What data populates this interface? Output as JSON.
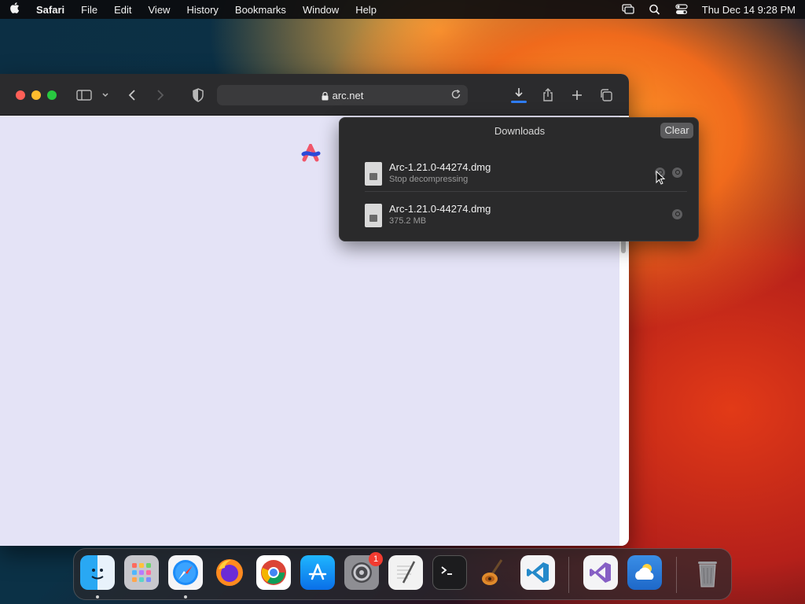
{
  "menubar": {
    "apple": "",
    "app_name": "Safari",
    "menus": [
      "File",
      "Edit",
      "View",
      "History",
      "Bookmarks",
      "Window",
      "Help"
    ],
    "datetime": "Thu Dec 14  9:28 PM"
  },
  "safari": {
    "url": "arc.net",
    "toolbar_icons": [
      "sidebar-icon",
      "chevron-down-icon",
      "back-icon",
      "forward-icon",
      "shield-icon",
      "reload-icon",
      "download-icon",
      "share-icon",
      "new-tab-icon",
      "tab-overview-icon"
    ]
  },
  "downloads": {
    "title": "Downloads",
    "clear_label": "Clear",
    "items": [
      {
        "name": "Arc-1.21.0-44274.dmg",
        "status": "Stop decompressing"
      },
      {
        "name": "Arc-1.21.0-44274.dmg",
        "status": "375.2 MB"
      }
    ]
  },
  "dock": {
    "apps": [
      "Finder",
      "Launchpad",
      "Safari",
      "Firefox",
      "Chrome",
      "App Store",
      "System Settings",
      "TextEdit",
      "Terminal",
      "GarageBand",
      "Visual Studio Code",
      "Visual Studio",
      "Weather",
      "Trash"
    ],
    "settings_badge": "1"
  },
  "colors": {
    "download_accent": "#2f7cf6",
    "badge": "#f23b30",
    "close": "#ff5f57",
    "minimize": "#febc2e",
    "zoom": "#28c840"
  }
}
